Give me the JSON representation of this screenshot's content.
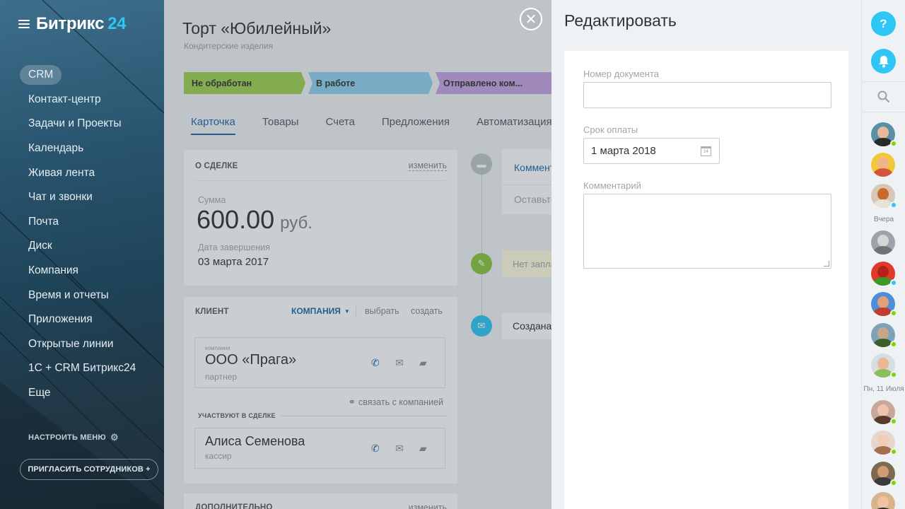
{
  "sidebar": {
    "logo_text": "Битрикс",
    "logo_number": "24",
    "menu": [
      "CRM",
      "Контакт-центр",
      "Задачи и Проекты",
      "Календарь",
      "Живая лента",
      "Чат и звонки",
      "Почта",
      "Диск",
      "Компания",
      "Время и отчеты",
      "Приложения",
      "Открытые линии",
      "1С + CRM Битрикс24",
      "Еще"
    ],
    "active_item": "CRM",
    "setup_label": "НАСТРОИТЬ МЕНЮ",
    "invite_label": "ПРИГЛАСИТЬ СОТРУДНИКОВ +"
  },
  "deal": {
    "title": "Торт «Юбилейный»",
    "subtitle": "Кондитерские изделия",
    "stages": [
      "Не обработан",
      "В работе",
      "Отправлено ком..."
    ],
    "tabs": [
      "Карточка",
      "Товары",
      "Счета",
      "Предложения",
      "Автоматизация"
    ],
    "active_tab": "Карточка",
    "about": {
      "header": "О СДЕЛКЕ",
      "edit": "изменить",
      "sum_label": "Сумма",
      "sum_value": "600.00",
      "currency": "руб.",
      "close_label": "Дата завершения",
      "close_value": "03 марта 2017"
    },
    "client": {
      "header": "КЛИЕНТ",
      "type_select": "КОМПАНИЯ",
      "choose": "выбрать",
      "create": "создать",
      "company_caption": "компания",
      "company_name": "ООО «Прага»",
      "company_role": "партнер",
      "link_company": "связать с компанией",
      "participants_header": "УЧАСТВУЮТ В СДЕЛКЕ",
      "contact_name": "Алиса Семенова",
      "contact_role": "кассир"
    },
    "additional": {
      "header": "ДОПОЛНИТЕЛЬНО",
      "edit": "изменить"
    },
    "timeline": {
      "tab_comment": "Комментарий",
      "comment_placeholder": "Оставьте комментарий",
      "planned": "Нет запланированных дел",
      "created": "Создана сделка"
    }
  },
  "edit_panel": {
    "title": "Редактировать",
    "doc_number_label": "Номер документа",
    "doc_number_value": "",
    "due_label": "Срок оплаты",
    "due_value": "1 марта 2018",
    "calendar_day": "24",
    "comment_label": "Комментарий",
    "comment_value": ""
  },
  "rail": {
    "help": "?",
    "date_yesterday": "Вчера",
    "date_monday": "Пн, 11 Июля"
  },
  "colors": {
    "accent": "#2fc6f6",
    "link": "#2067b0",
    "stage_new": "#9ed253",
    "stage_work": "#8fd1ef",
    "stage_sent": "#c6a2e3",
    "online": "#7bd500"
  }
}
